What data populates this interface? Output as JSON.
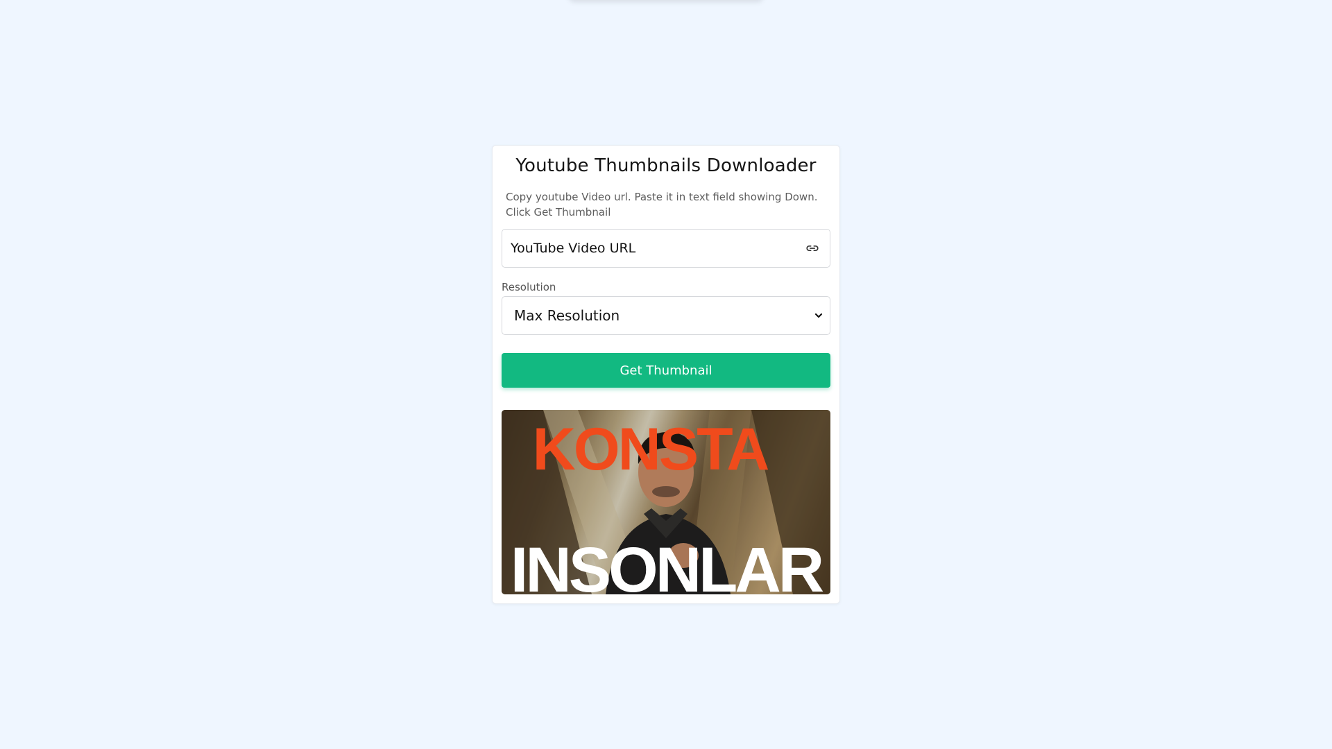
{
  "card": {
    "title": "Youtube Thumbnails Downloader",
    "description": "Copy youtube Video url. Paste it in text field showing Down. Click Get Thumbnail"
  },
  "url_input": {
    "placeholder": "YouTube Video URL",
    "icon": "link-icon"
  },
  "resolution": {
    "label": "Resolution",
    "selected": "Max Resolution"
  },
  "get_button": {
    "label": "Get Thumbnail",
    "color": "#12b981"
  },
  "thumbnail": {
    "top_text": "KONSTA",
    "bottom_text": "INSONLAR",
    "top_text_color": "#f04b1c",
    "bottom_text_color": "#ffffff"
  },
  "colors": {
    "background": "#eff6ff",
    "card": "#ffffff",
    "accent": "#12b981"
  }
}
